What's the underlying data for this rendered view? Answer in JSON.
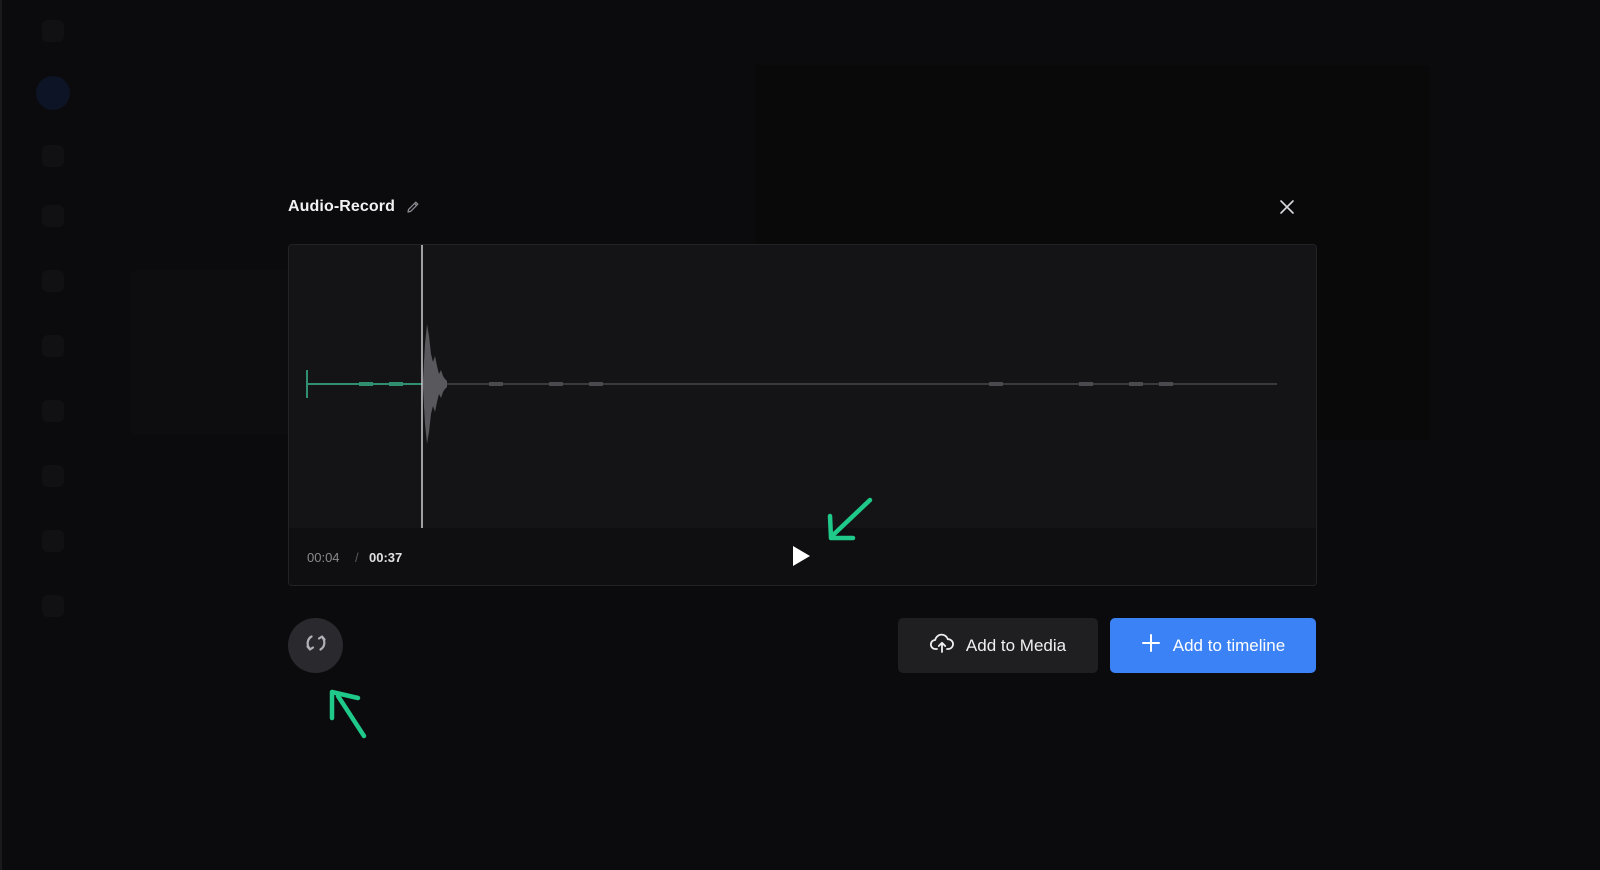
{
  "dialog": {
    "title": "Audio-Record",
    "icons": {
      "edit": "pencil-icon",
      "close": "close-icon"
    }
  },
  "player": {
    "current_time": "00:04",
    "separator": "/",
    "total_time": "00:37",
    "progress_fraction": 0.108,
    "icons": {
      "play": "play-icon"
    },
    "colors": {
      "played_wave": "#2f8f6e",
      "unplayed_wave": "#3a3a3e",
      "playhead": "#cfcfd3"
    }
  },
  "actions": {
    "retake_icon": "refresh-icon",
    "add_to_media_label": "Add to Media",
    "add_to_media_icon": "cloud-upload-icon",
    "add_to_timeline_label": "Add to timeline",
    "add_to_timeline_icon": "plus-icon",
    "accent_color": "#3b82f6"
  },
  "annotations": {
    "arrow_color": "#1fc98a"
  }
}
